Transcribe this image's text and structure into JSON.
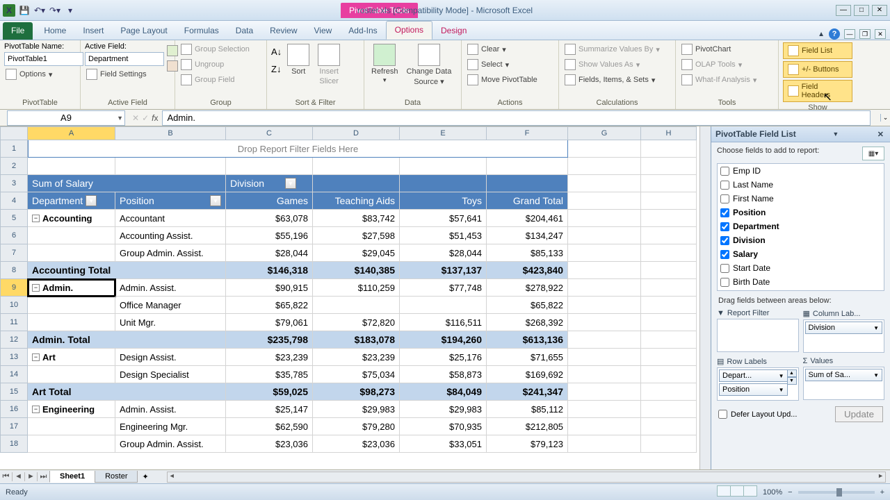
{
  "title": "roster.xls  [Compatibility Mode] - Microsoft Excel",
  "context_tab": "PivotTable Tools",
  "tabs": [
    "File",
    "Home",
    "Insert",
    "Page Layout",
    "Formulas",
    "Data",
    "Review",
    "View",
    "Add-Ins",
    "Options",
    "Design"
  ],
  "ribbon": {
    "pivottable": {
      "name_label": "PivotTable Name:",
      "name_value": "PivotTable1",
      "options": "Options",
      "group": "PivotTable"
    },
    "active_field": {
      "label": "Active Field:",
      "value": "Department",
      "settings": "Field Settings",
      "group": "Active Field"
    },
    "group_grp": {
      "sel": "Group Selection",
      "ungroup": "Ungroup",
      "field": "Group Field",
      "group": "Group"
    },
    "sort_filter": {
      "sort": "Sort",
      "slicer_l1": "Insert",
      "slicer_l2": "Slicer",
      "group": "Sort & Filter"
    },
    "data": {
      "refresh": "Refresh",
      "change_l1": "Change Data",
      "change_l2": "Source",
      "group": "Data"
    },
    "actions": {
      "clear": "Clear",
      "select": "Select",
      "move": "Move PivotTable",
      "group": "Actions"
    },
    "calc": {
      "summarize": "Summarize Values By",
      "show_as": "Show Values As",
      "fields": "Fields, Items, & Sets",
      "group": "Calculations"
    },
    "tools": {
      "chart": "PivotChart",
      "olap": "OLAP Tools",
      "whatif": "What-If Analysis",
      "group": "Tools"
    },
    "show": {
      "flist": "Field List",
      "pm": "+/- Buttons",
      "hdr": "Field Headers",
      "group": "Show"
    }
  },
  "name_box": "A9",
  "formula_value": "Admin.",
  "columns": [
    "A",
    "B",
    "C",
    "D",
    "E",
    "F",
    "G",
    "H"
  ],
  "pivot": {
    "filter_drop": "Drop Report Filter Fields Here",
    "value_label": "Sum of Salary",
    "col_field": "Division",
    "row_field1": "Department",
    "row_field2": "Position",
    "col_headers": [
      "Games",
      "Teaching Aids",
      "Toys",
      "Grand Total"
    ],
    "rows": [
      {
        "r": 5,
        "dept": "Accounting",
        "pos": "Accountant",
        "v": [
          "$63,078",
          "$83,742",
          "$57,641",
          "$204,461"
        ],
        "first": true
      },
      {
        "r": 6,
        "pos": "Accounting Assist.",
        "v": [
          "$55,196",
          "$27,598",
          "$51,453",
          "$134,247"
        ]
      },
      {
        "r": 7,
        "pos": "Group Admin. Assist.",
        "v": [
          "$28,044",
          "$29,045",
          "$28,044",
          "$85,133"
        ]
      },
      {
        "r": 8,
        "total": "Accounting Total",
        "v": [
          "$146,318",
          "$140,385",
          "$137,137",
          "$423,840"
        ]
      },
      {
        "r": 9,
        "dept": "Admin.",
        "pos": "Admin. Assist.",
        "v": [
          "$90,915",
          "$110,259",
          "$77,748",
          "$278,922"
        ],
        "first": true,
        "selected": true
      },
      {
        "r": 10,
        "pos": "Office Manager",
        "v": [
          "$65,822",
          "",
          "",
          "$65,822"
        ]
      },
      {
        "r": 11,
        "pos": "Unit Mgr.",
        "v": [
          "$79,061",
          "$72,820",
          "$116,511",
          "$268,392"
        ]
      },
      {
        "r": 12,
        "total": "Admin. Total",
        "v": [
          "$235,798",
          "$183,078",
          "$194,260",
          "$613,136"
        ]
      },
      {
        "r": 13,
        "dept": "Art",
        "pos": "Design Assist.",
        "v": [
          "$23,239",
          "$23,239",
          "$25,176",
          "$71,655"
        ],
        "first": true
      },
      {
        "r": 14,
        "pos": "Design Specialist",
        "v": [
          "$35,785",
          "$75,034",
          "$58,873",
          "$169,692"
        ]
      },
      {
        "r": 15,
        "total": "Art Total",
        "v": [
          "$59,025",
          "$98,273",
          "$84,049",
          "$241,347"
        ]
      },
      {
        "r": 16,
        "dept": "Engineering",
        "pos": "Admin. Assist.",
        "v": [
          "$25,147",
          "$29,983",
          "$29,983",
          "$85,112"
        ],
        "first": true
      },
      {
        "r": 17,
        "pos": "Engineering Mgr.",
        "v": [
          "$62,590",
          "$79,280",
          "$70,935",
          "$212,805"
        ]
      },
      {
        "r": 18,
        "pos": "Group Admin. Assist.",
        "v": [
          "$23,036",
          "$23,036",
          "$33,051",
          "$79,123"
        ]
      }
    ]
  },
  "field_list": {
    "title": "PivotTable Field List",
    "choose": "Choose fields to add to report:",
    "fields": [
      {
        "name": "Emp ID",
        "c": false
      },
      {
        "name": "Last Name",
        "c": false
      },
      {
        "name": "First Name",
        "c": false
      },
      {
        "name": "Position",
        "c": true
      },
      {
        "name": "Department",
        "c": true
      },
      {
        "name": "Division",
        "c": true
      },
      {
        "name": "Salary",
        "c": true
      },
      {
        "name": "Start Date",
        "c": false
      },
      {
        "name": "Birth Date",
        "c": false
      }
    ],
    "drag_label": "Drag fields between areas below:",
    "areas": {
      "filter": "Report Filter",
      "columns": "Column Lab...",
      "rows": "Row Labels",
      "values": "Values",
      "col_chip": "Division",
      "row_chip1": "Depart...",
      "row_chip2": "Position",
      "val_chip": "Sum of Sa..."
    },
    "defer": "Defer Layout Upd...",
    "update": "Update"
  },
  "sheets": {
    "s1": "Sheet1",
    "s2": "Roster"
  },
  "status": {
    "ready": "Ready",
    "zoom": "100%"
  }
}
